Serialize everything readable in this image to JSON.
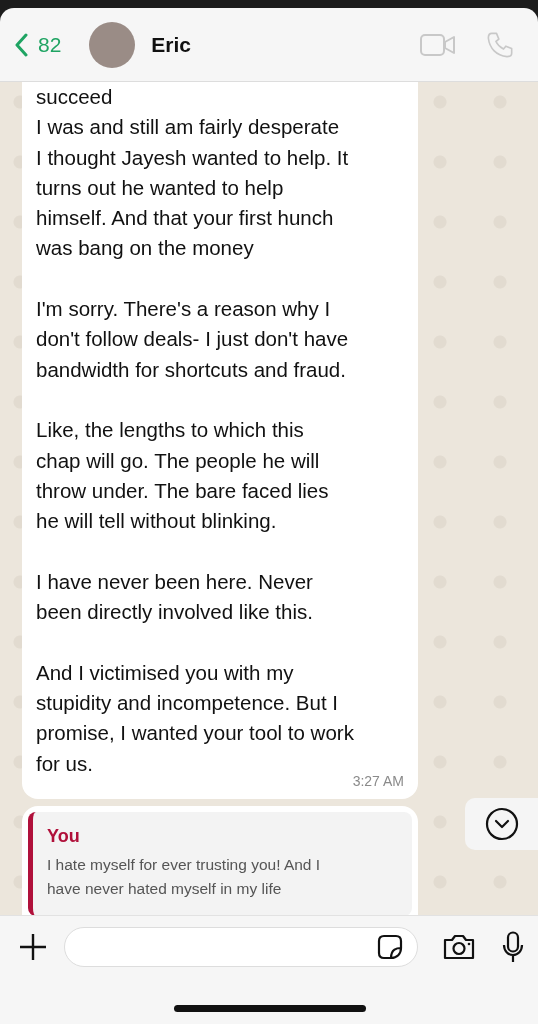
{
  "header": {
    "back_count": "82",
    "contact_name": "Eric"
  },
  "message": {
    "paragraphs": [
      [
        "succeed",
        "I was and still am fairly desperate",
        "I thought Jayesh wanted to help.  It",
        "turns out he wanted to help",
        "himself.  And that your first hunch",
        "was bang on the money"
      ],
      [
        "I'm sorry. There's a reason why I",
        "don't follow deals- I just don't have",
        "bandwidth for shortcuts and fraud."
      ],
      [
        "Like, the lengths to which this",
        "chap will go. The people he will",
        "throw under.  The bare faced lies",
        "he will tell without blinking."
      ],
      [
        "I have never been here. Never",
        "been directly involved like this."
      ],
      [
        "And I victimised you with my",
        "stupidity and incompetence. But I",
        "promise, I wanted your tool to work",
        "for us."
      ]
    ],
    "time": "3:27 AM"
  },
  "quoted": {
    "author": "You",
    "lines": [
      "I hate myself for ever trusting you! And I",
      "have never hated myself in my life"
    ]
  }
}
